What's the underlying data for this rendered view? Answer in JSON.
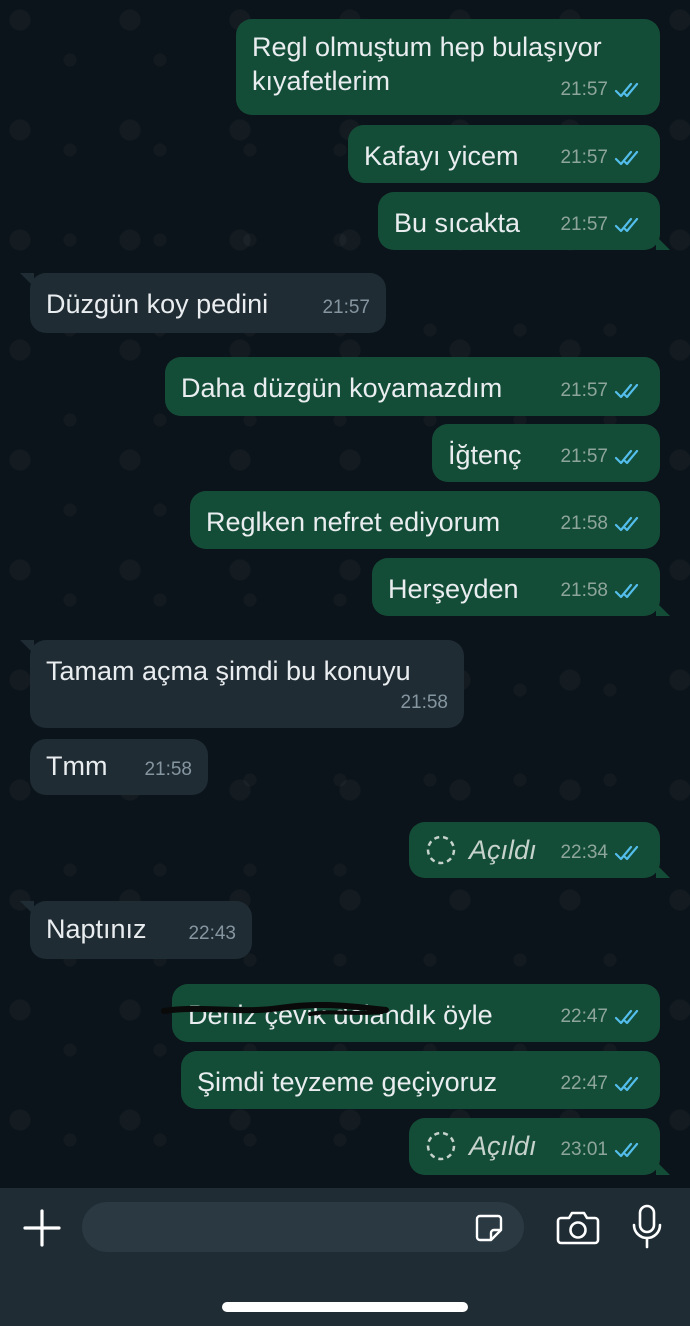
{
  "messages": [
    {
      "direction": "outgoing",
      "text": "Regl olmuştum hep bulaşıyor",
      "text2": "kıyafetlerim",
      "time": "21:57"
    },
    {
      "direction": "outgoing",
      "text": "Kafayı yicem",
      "time": "21:57"
    },
    {
      "direction": "outgoing",
      "text": "Bu sıcakta",
      "time": "21:57"
    },
    {
      "direction": "incoming",
      "text": "Düzgün koy pedini",
      "time": "21:57"
    },
    {
      "direction": "outgoing",
      "text": "Daha düzgün koyamazdım",
      "time": "21:57"
    },
    {
      "direction": "outgoing",
      "text": "İğtenç",
      "time": "21:57"
    },
    {
      "direction": "outgoing",
      "text": "Reglken nefret ediyorum",
      "time": "21:58"
    },
    {
      "direction": "outgoing",
      "text": "Herşeyden",
      "time": "21:58"
    },
    {
      "direction": "incoming",
      "text": "Tamam açma şimdi bu konuyu",
      "time": "21:58"
    },
    {
      "direction": "incoming",
      "text": "Tmm",
      "time": "21:58"
    },
    {
      "direction": "outgoing",
      "text": "Açıldı",
      "type": "view-once-opened",
      "time": "22:34"
    },
    {
      "direction": "incoming",
      "text": "Naptınız",
      "time": "22:43"
    },
    {
      "direction": "outgoing",
      "text": "Deniz çevik dolandık öyle",
      "time": "22:47",
      "redacted": true
    },
    {
      "direction": "outgoing",
      "text": "Şimdi teyzeme geçiyoruz",
      "time": "22:47"
    },
    {
      "direction": "outgoing",
      "text": "Açıldı",
      "type": "view-once-opened",
      "time": "23:01"
    }
  ],
  "input": {
    "placeholder": ""
  },
  "icons": {
    "attach": "plus-icon",
    "sticker": "sticker-icon",
    "camera": "camera-icon",
    "mic": "microphone-icon",
    "read": "double-check-icon",
    "viewonce": "view-once-icon"
  },
  "colors": {
    "background": "#0b141a",
    "outgoing": "#144d37",
    "incoming": "#1f2c34",
    "read_ticks": "#53bdeb",
    "text": "#e9edef"
  }
}
